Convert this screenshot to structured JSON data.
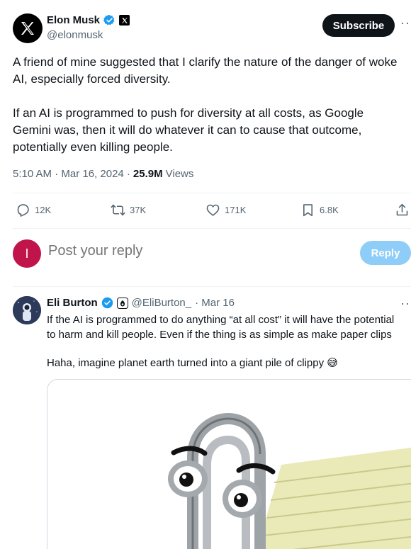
{
  "tweet": {
    "author_name": "Elon Musk",
    "author_handle": "@elonmusk",
    "subscribe_label": "Subscribe",
    "more_label": "···",
    "paragraph1_line1": "A friend of mine suggested that I clarify the nature of the danger of woke",
    "paragraph1_line2": "AI, especially forced diversity.",
    "paragraph2_line1": "If an AI is programmed to push for diversity at all costs, as Google",
    "paragraph2_line2": "Gemini was, then it will do whatever it can to cause that outcome,",
    "paragraph2_line3": "potentially even killing people.",
    "timestamp": "5:10 AM · Mar 16, 2024 ·",
    "views_count": "25.9M",
    "views_label": "Views"
  },
  "actions": {
    "replies": "12K",
    "reposts": "37K",
    "likes": "171K",
    "bookmarks": "6.8K"
  },
  "composer": {
    "avatar_letter": "I",
    "placeholder": "Post your reply",
    "reply_label": "Reply"
  },
  "reply_tweet": {
    "author_name": "Eli Burton",
    "author_handle": "@EliBurton_",
    "date": "· Mar 16",
    "more_label": "···",
    "line1": "If the AI is programmed to do anything “at all cost” it will have the potential",
    "line2": "to harm and kill people. Even if the thing is as simple as make paper clips",
    "line3": "Haha, imagine planet earth turned into a giant pile of clippy 😅"
  },
  "colors": {
    "accent": "#1d9bf0",
    "text": "#0f1419",
    "muted": "#536471",
    "reply_button": "#8ecdf8",
    "reply_avatar": "#c0144a"
  },
  "icons": [
    "x-logo-icon",
    "verified-badge-icon",
    "reply-icon",
    "repost-icon",
    "like-icon",
    "bookmark-icon",
    "share-icon",
    "clippy-image"
  ]
}
